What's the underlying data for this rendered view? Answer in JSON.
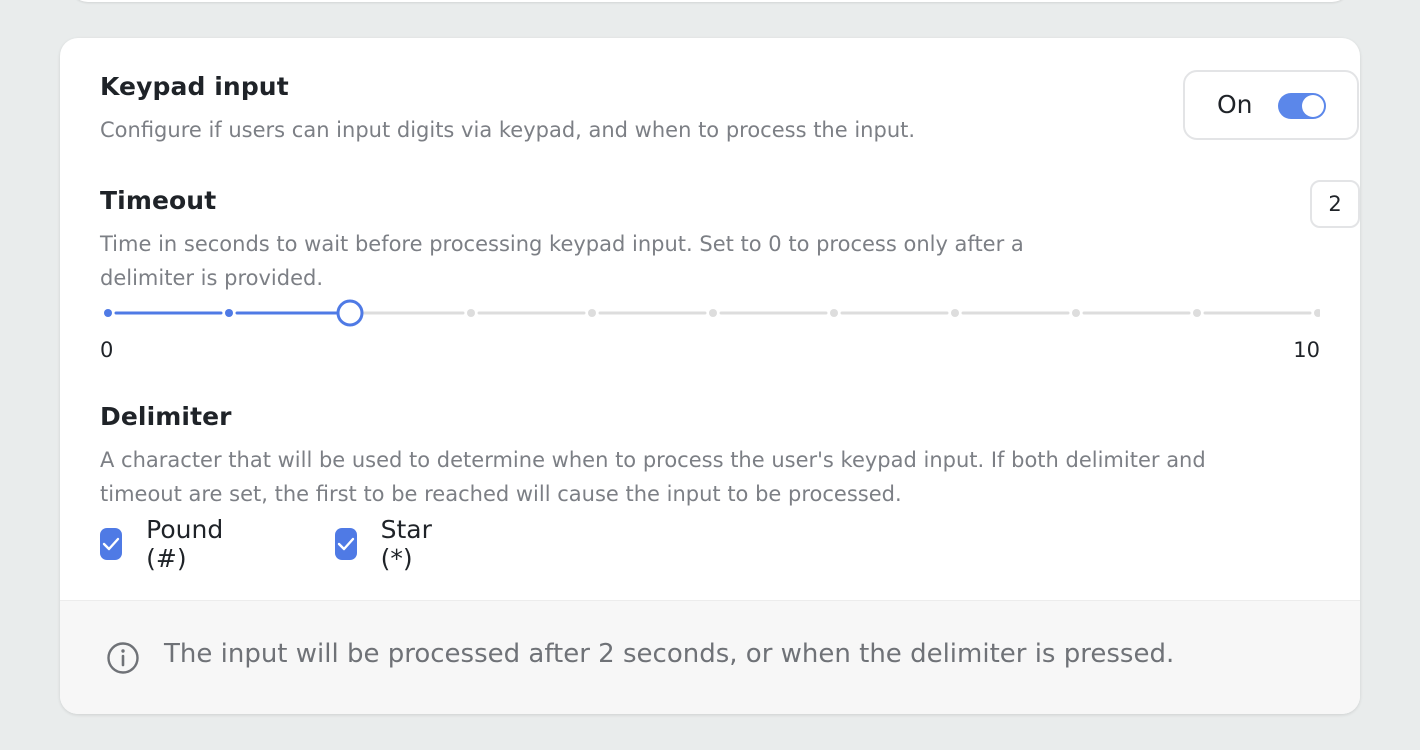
{
  "keypad": {
    "title": "Keypad input",
    "description": "Configure if users can input digits via keypad, and when to process the input.",
    "toggle_label": "On",
    "toggle_on": true
  },
  "timeout": {
    "title": "Timeout",
    "description_line1": "Time in seconds to wait before processing keypad input. Set to 0 to process only after a",
    "description_line2": "delimiter is provided.",
    "value": "2",
    "slider": {
      "min": 0,
      "max": 10,
      "value": 2,
      "min_label": "0",
      "max_label": "10"
    }
  },
  "delimiter": {
    "title": "Delimiter",
    "description_line1": "A character that will be used to determine when to process the user's keypad input. If both delimiter and",
    "description_line2": "timeout are set, the first to be reached will cause the input to be processed.",
    "options": [
      {
        "label": "Pound (#)",
        "checked": true
      },
      {
        "label": "Star (*)",
        "checked": true
      }
    ]
  },
  "footer": {
    "icon": "info-icon",
    "text": "The input will be processed after 2 seconds, or when the delimiter is pressed."
  },
  "colors": {
    "accent": "#4f7ae5",
    "toggle": "#5b87ea",
    "track_inactive": "#dddddd"
  }
}
